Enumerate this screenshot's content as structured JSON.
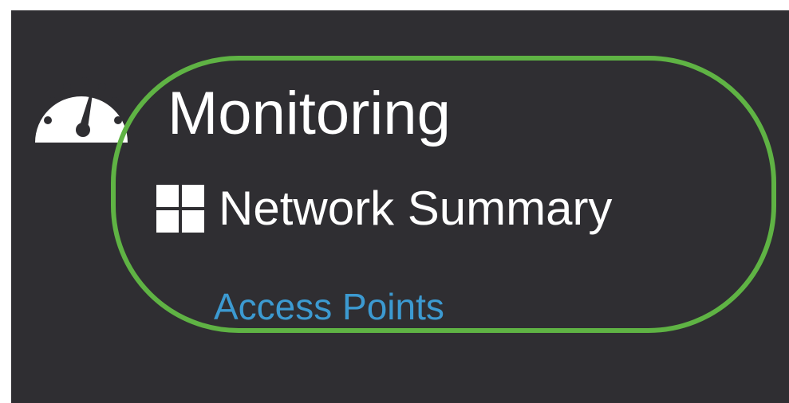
{
  "colors": {
    "panel_background": "#2f2e32",
    "highlight_ring": "#5fb344",
    "primary_text": "#ffffff",
    "link_text": "#3c9ad1"
  },
  "menu": {
    "section": {
      "label": "Monitoring",
      "icon": "dashboard-gauge-icon"
    },
    "items": [
      {
        "label": "Network Summary",
        "icon": "grid-icon"
      },
      {
        "label": "Access Points",
        "icon": ""
      },
      {
        "label": "",
        "icon": ""
      }
    ]
  }
}
